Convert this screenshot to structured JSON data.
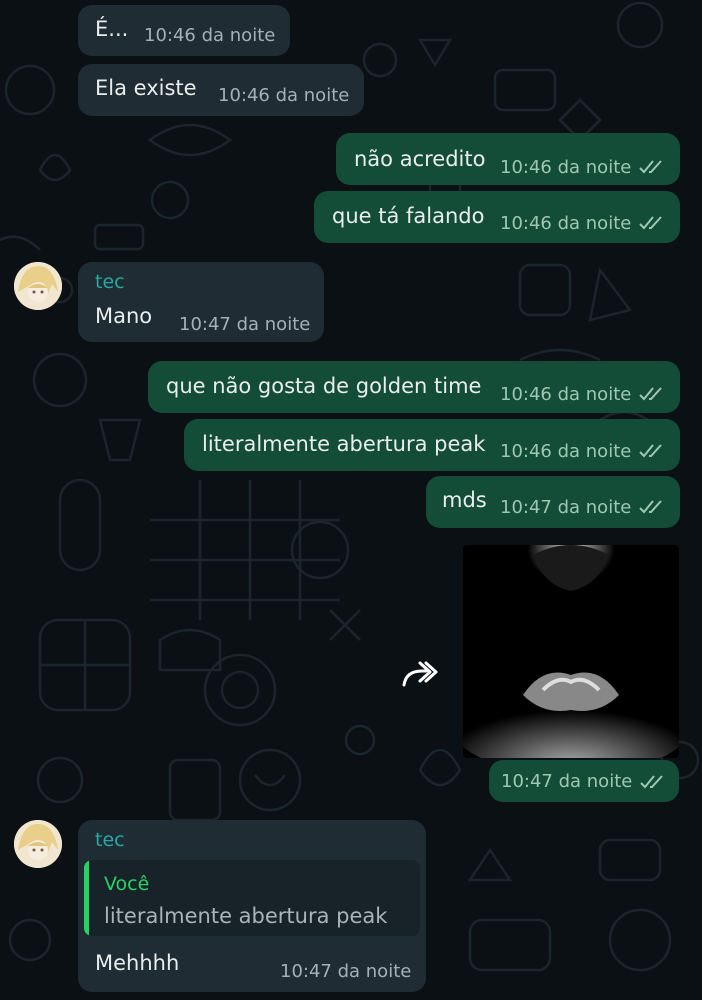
{
  "messages": [
    {
      "id": "m1",
      "text": "É...",
      "time": "10:46 da noite"
    },
    {
      "id": "m2",
      "text": "Ela existe",
      "time": "10:46 da noite"
    },
    {
      "id": "m3",
      "text": "não acredito",
      "time": "10:46 da noite"
    },
    {
      "id": "m4",
      "text": "que tá falando",
      "time": "10:46 da noite"
    },
    {
      "id": "m5",
      "sender": "tec",
      "text": "Mano",
      "time": "10:47 da noite"
    },
    {
      "id": "m6",
      "text": "que não gosta de golden time",
      "time": "10:46 da noite"
    },
    {
      "id": "m7",
      "text": "literalmente abertura peak",
      "time": "10:46 da noite"
    },
    {
      "id": "m8",
      "text": "mds",
      "time": "10:47 da noite"
    },
    {
      "id": "m9",
      "time": "10:47 da noite"
    },
    {
      "id": "m10",
      "sender": "tec",
      "quote_author": "Você",
      "quote_text": "literalmente abertura peak",
      "text": "Mehhhh",
      "time": "10:47 da noite"
    }
  ],
  "icons": {
    "read_receipt": "double-check-icon",
    "forward": "forward-icon"
  },
  "colors": {
    "background": "#0b1014",
    "incoming_bubble": "#1f2c33",
    "outgoing_bubble": "#134d37",
    "sender_name": "#27a9a1",
    "quote_accent": "#25d366",
    "read_ticks": "#9fc7b3"
  }
}
